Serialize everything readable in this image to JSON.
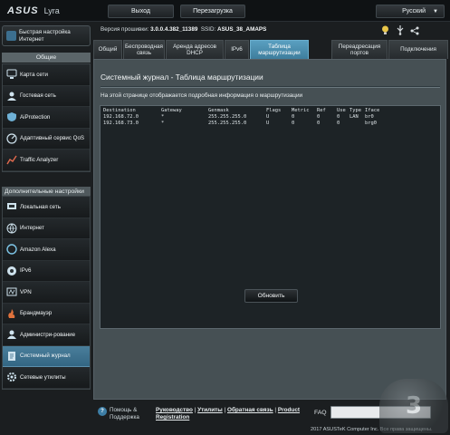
{
  "header": {
    "brand": "ASUS",
    "model": "Lyra",
    "logout_label": "Выход",
    "reboot_label": "Перезагрузка",
    "language": "Русский"
  },
  "sidebar": {
    "quick_setup": "Быстрая настройка Интернет",
    "general_title": "Общие",
    "general_items": [
      {
        "label": "Карта сети",
        "icon": "network-map-icon"
      },
      {
        "label": "Гостевая сеть",
        "icon": "guest-network-icon"
      },
      {
        "label": "AiProtection",
        "icon": "shield-icon"
      },
      {
        "label": "Адаптивный сервис QoS",
        "icon": "qos-icon"
      },
      {
        "label": "Traffic Analyzer",
        "icon": "chart-icon"
      }
    ],
    "advanced_title": "Дополнительные настройки",
    "advanced_items": [
      {
        "label": "Локальная сеть",
        "icon": "lan-icon"
      },
      {
        "label": "Интернет",
        "icon": "globe-icon"
      },
      {
        "label": "Amazon Alexa",
        "icon": "alexa-icon"
      },
      {
        "label": "IPv6",
        "icon": "ipv6-icon"
      },
      {
        "label": "VPN",
        "icon": "vpn-icon"
      },
      {
        "label": "Брандмауэр",
        "icon": "firewall-icon"
      },
      {
        "label": "Администри-рование",
        "icon": "admin-icon"
      },
      {
        "label": "Системный журнал",
        "icon": "log-icon",
        "active": true
      },
      {
        "label": "Сетевые утилиты",
        "icon": "gear-icon"
      }
    ]
  },
  "firmware": {
    "label": "Версия прошивки:",
    "version": "3.0.0.4.382_11389",
    "ssid_label": "SSID:",
    "ssid": "ASUS_38_AMAPS"
  },
  "tabs": [
    {
      "label": "Общий"
    },
    {
      "label": "Беспроводная связь"
    },
    {
      "label": "Аренда адресов DHCP"
    },
    {
      "label": "IPv6"
    },
    {
      "label": "Таблица маршрутизации",
      "active": true
    },
    {
      "label": "Переадресация портов"
    },
    {
      "label": "Подключения"
    }
  ],
  "panel": {
    "title": "Системный журнал - Таблица маршрутизации",
    "description": "На этой странице отображается подробная информация о маршрутизации",
    "columns": [
      "Destination",
      "Gateway",
      "Genmask",
      "Flags",
      "Metric",
      "Ref",
      "Use",
      "Type",
      "Iface"
    ],
    "rows": [
      [
        "192.168.72.0",
        "*",
        "255.255.255.0",
        "U",
        "0",
        "0",
        "0",
        "LAN",
        "br0"
      ],
      [
        "192.168.73.0",
        "*",
        "255.255.255.0",
        "U",
        "0",
        "0",
        "0",
        "",
        "brg0"
      ]
    ],
    "refresh_label": "Обновить"
  },
  "footer": {
    "help_label": "Помощь & Поддержка",
    "links": [
      "Руководство",
      "Утилиты",
      "Обратная связь",
      "Product Registration"
    ],
    "faq_label": "FAQ",
    "copyright": "2017 ASUSTeK Computer Inc. Все права защищены."
  },
  "watermark": "3"
}
